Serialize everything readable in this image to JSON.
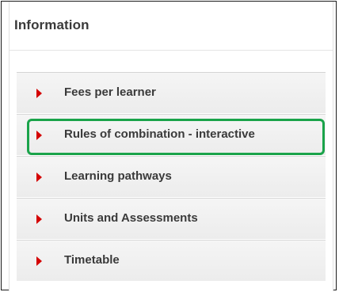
{
  "panel": {
    "title": "Information"
  },
  "menu": {
    "items": [
      {
        "label": "Fees per learner",
        "highlighted": false
      },
      {
        "label": "Rules of combination - interactive",
        "highlighted": true
      },
      {
        "label": "Learning pathways",
        "highlighted": false
      },
      {
        "label": "Units and Assessments",
        "highlighted": false
      },
      {
        "label": "Timetable",
        "highlighted": false
      }
    ],
    "arrow_icon": "triangle-right-icon",
    "arrow_color": "#d40000",
    "highlight_color": "#1aa34a"
  }
}
